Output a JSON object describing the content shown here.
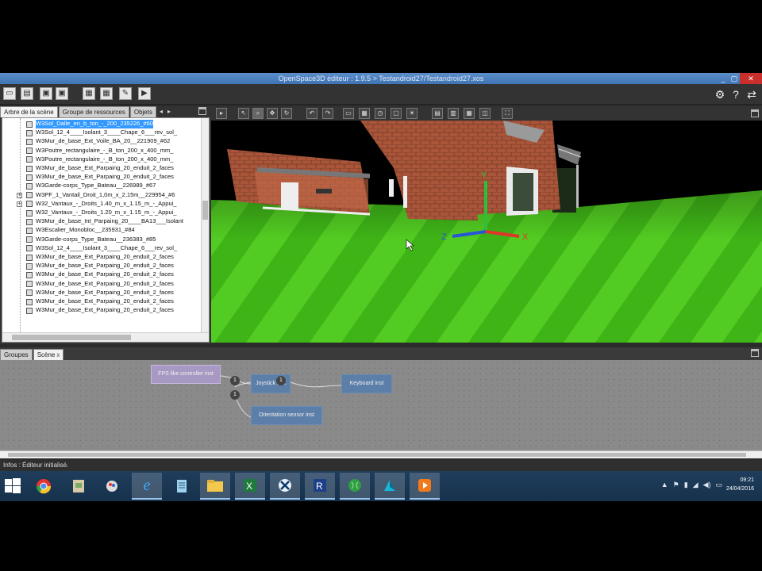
{
  "window": {
    "title": "OpenSpace3D éditeur : 1.9.5 > Testandroid27/Testandroid27.xos",
    "minimize": "_",
    "maximize": "▢",
    "close": "✕"
  },
  "toolbar": {
    "right_icons": [
      "gear-icon",
      "help-icon",
      "update-icon"
    ],
    "settings_glyph": "⚙",
    "help_glyph": "?",
    "update_glyph": "⇄"
  },
  "scene_panel": {
    "tabs": [
      "Arbre de la scène",
      "Groupe de ressources",
      "Objets"
    ],
    "active_tab": 0,
    "prev_arrow": "◂",
    "next_arrow": "▸",
    "tree_items": [
      "W3Sol_Dalle_en_b_ton_-_200_235226_#60",
      "W3Sol_12_4____Isolant_3____Chape_6___rev_sol_",
      "W3Mur_de_base_Ext_Voile_BA_20__221909_#62",
      "W3Poutre_rectangulaire_-_B_ton_200_x_400_mm_",
      "W3Poutre_rectangulaire_-_B_ton_200_x_400_mm_",
      "W3Mur_de_base_Ext_Parpaing_20_enduit_2_faces",
      "W3Mur_de_base_Ext_Parpaing_20_enduit_2_faces",
      "W3Garde-corps_Type_Bateau__226989_#67",
      "W3PF_1_Vantail_Droit_1,0m_x_2,15m__229954_#6",
      "W32_Vantaux_-_Droits_1.40_m_x_1.15_m_-_Appui_",
      "W32_Vantaux_-_Droits_1.20_m_x_1.15_m_-_Appui_",
      "W3Mur_de_base_Int_Parpaing_20____BA13___Isolant",
      "W3Escalier_Monobloc__235931_#84",
      "W3Garde-corps_Type_Bateau__236383_#85",
      "W3Sol_12_4____Isolant_3____Chape_6___rev_sol_",
      "W3Mur_de_base_Ext_Parpaing_20_enduit_2_faces",
      "W3Mur_de_base_Ext_Parpaing_20_enduit_2_faces",
      "W3Mur_de_base_Ext_Parpaing_20_enduit_2_faces",
      "W3Mur_de_base_Ext_Parpaing_20_enduit_2_faces",
      "W3Mur_de_base_Ext_Parpaing_20_enduit_2_faces",
      "W3Mur_de_base_Ext_Parpaing_20_enduit_2_faces",
      "W3Mur_de_base_Ext_Parpaing_20_enduit_2_faces"
    ],
    "selected_index": 0,
    "expandable_indices": [
      8,
      9
    ],
    "expander_glyph": "+"
  },
  "viewport": {
    "axis_labels": {
      "x": "X",
      "y": "Y",
      "z": "Z"
    },
    "axis_colors": {
      "x": "#e0362c",
      "y": "#2fbf3a",
      "z": "#2a55d6"
    },
    "sky_color": "#000000",
    "grass_color": "#49c31c",
    "brick_color": "#a8553a"
  },
  "graph_panel": {
    "tabs": [
      "Groupes",
      "Scène"
    ],
    "active_tab": 1,
    "close_glyph": "x",
    "nodes": [
      {
        "label": "FPS like controller inst",
        "kind": "purple"
      },
      {
        "label": "Joystick inst",
        "kind": "blue"
      },
      {
        "label": "Keyboard inst",
        "kind": "blue"
      },
      {
        "label": "Orientation sensor inst",
        "kind": "blue"
      }
    ],
    "port_labels": [
      "1",
      "1",
      "1"
    ]
  },
  "status": {
    "text": "Infos : Éditeur initialisé."
  },
  "taskbar": {
    "apps": [
      "chrome-icon",
      "explorer-paint-icon",
      "paint-icon",
      "internet-explorer-icon",
      "notepad-icon",
      "file-explorer-icon",
      "excel-icon",
      "openspace3d-icon",
      "revit-icon",
      "globe-icon",
      "autodesk-icon",
      "media-player-icon"
    ],
    "active_app": 7,
    "clock_time": "09:21",
    "clock_date": "24/04/2016"
  }
}
